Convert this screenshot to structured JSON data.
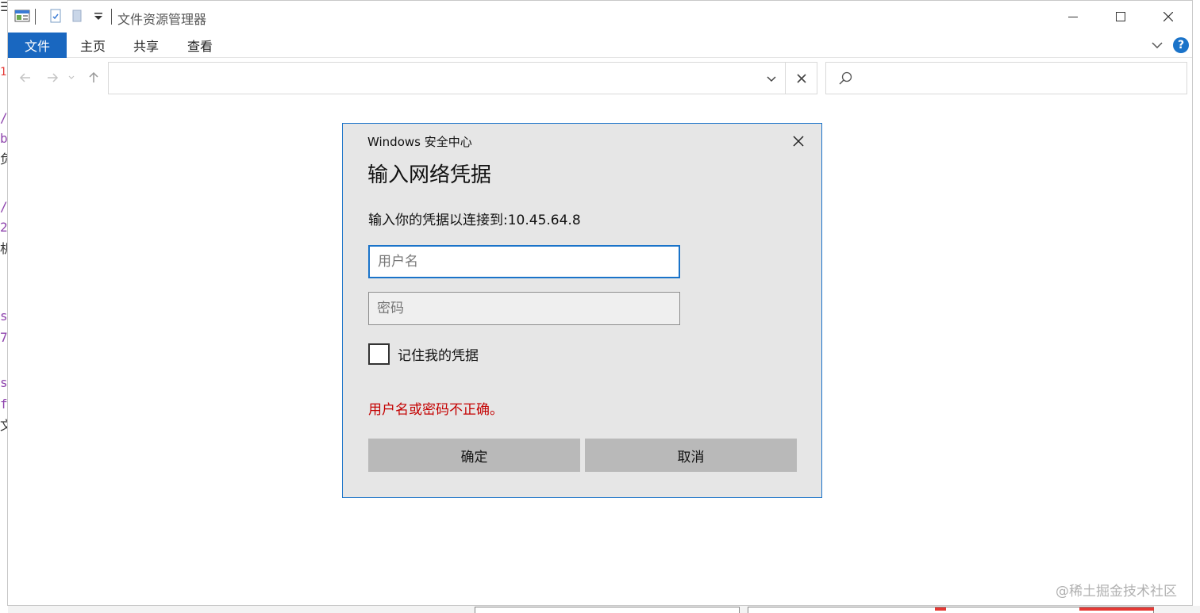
{
  "window": {
    "title": "文件资源管理器"
  },
  "ribbon": {
    "tabs": [
      "文件",
      "主页",
      "共享",
      "查看"
    ]
  },
  "navbar": {
    "address_value": "",
    "search_placeholder": ""
  },
  "dialog": {
    "title": "Windows 安全中心",
    "heading": "输入网络凭据",
    "message": "输入你的凭据以连接到:10.45.64.8",
    "username_placeholder": "用户名",
    "password_placeholder": "密码",
    "remember_label": "记住我的凭据",
    "remember_checked": false,
    "error": "用户名或密码不正确。",
    "ok_label": "确定",
    "cancel_label": "取消"
  },
  "background_chars": [
    {
      "text": "/",
      "color": "#8e44ad"
    },
    {
      "text": "b",
      "color": "#8e44ad"
    },
    {
      "text": "负",
      "color": "#333333"
    },
    {
      "text": "/",
      "color": "#8e44ad"
    },
    {
      "text": "2",
      "color": "#8e44ad"
    },
    {
      "text": "机",
      "color": "#333333"
    },
    {
      "text": "s",
      "color": "#8e44ad"
    },
    {
      "text": "7",
      "color": "#8e44ad"
    },
    {
      "text": "s",
      "color": "#8e44ad"
    },
    {
      "text": "f",
      "color": "#8e44ad"
    },
    {
      "text": "文",
      "color": "#333333"
    }
  ],
  "watermark": "@稀土掘金技术社区",
  "colors": {
    "accent": "#1a73c9",
    "file_tab": "#1967c0",
    "error": "#c40000",
    "dialog_bg": "#e6e6e6",
    "button_bg": "#b9b9b9"
  }
}
